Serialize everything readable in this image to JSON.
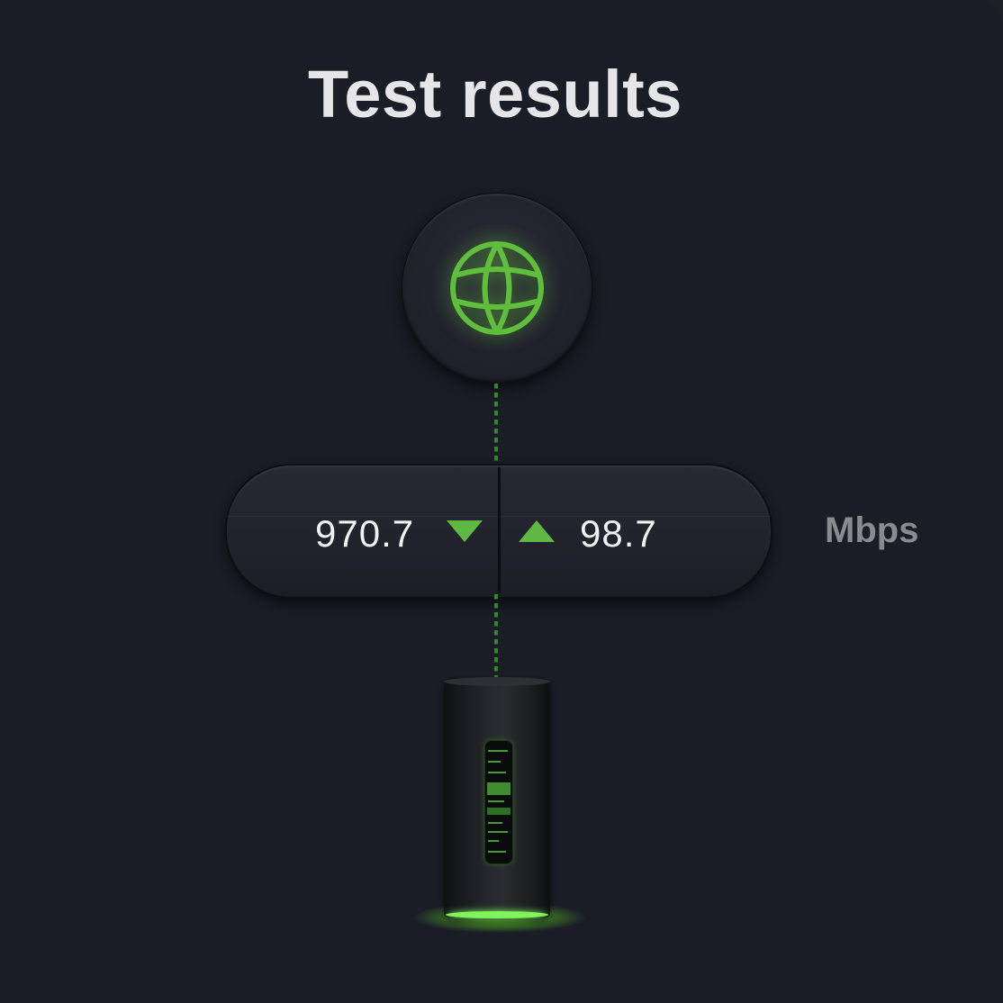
{
  "title": "Test results",
  "speeds": {
    "download": "970.7",
    "upload": "98.7",
    "unit": "Mbps"
  },
  "icons": {
    "internet": "globe-icon",
    "download": "triangle-down-icon",
    "upload": "triangle-up-icon",
    "device": "router-image"
  },
  "colors": {
    "background": "#1a1c26",
    "accent": "#5fb843",
    "text": "#f2f2f4",
    "unit_text": "#8a8b90"
  }
}
